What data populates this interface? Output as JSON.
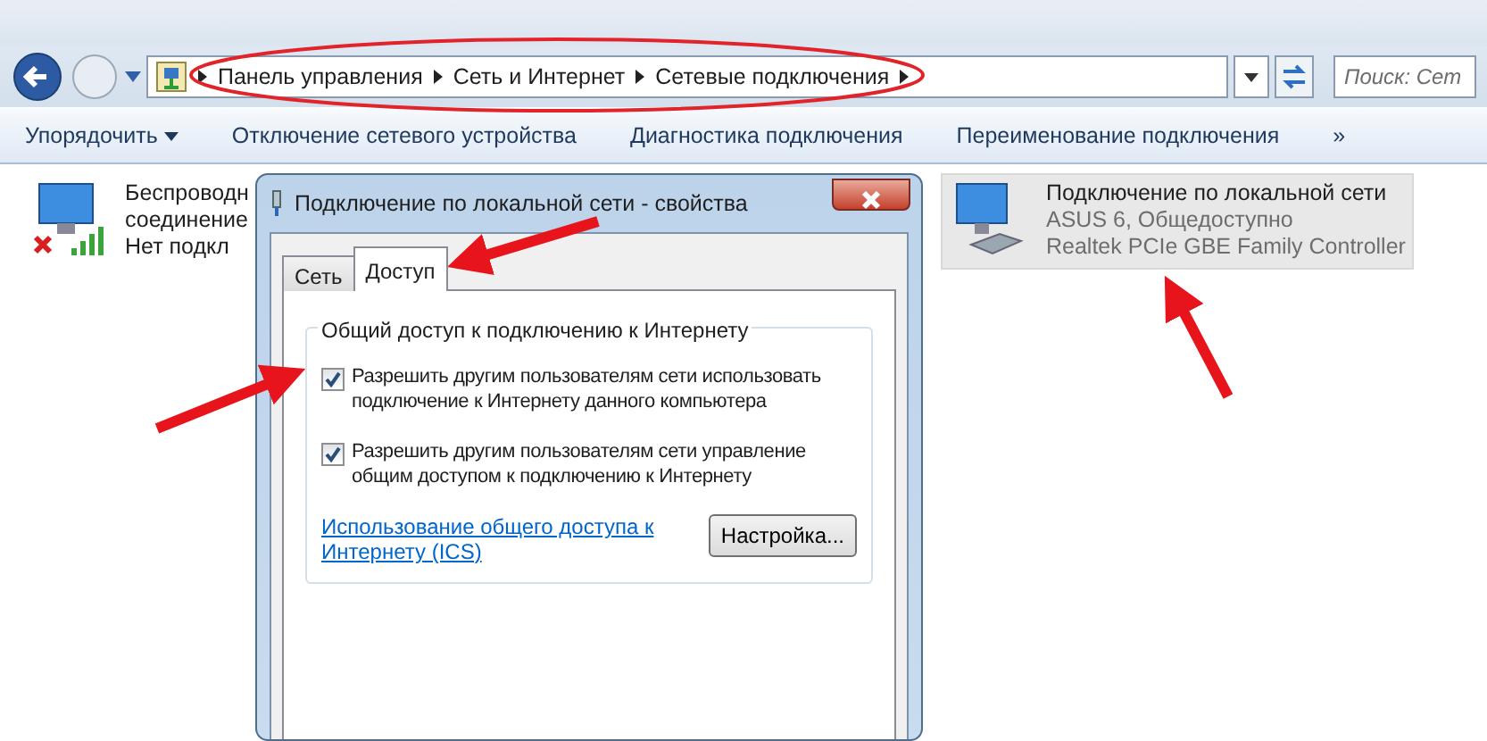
{
  "nav": {
    "breadcrumbs": [
      "Панель управления",
      "Сеть и Интернет",
      "Сетевые подключения"
    ],
    "search": {
      "placeholder": "Поиск: Сет"
    }
  },
  "toolbar": {
    "items": [
      {
        "label": "Упорядочить",
        "dropdown": true
      },
      {
        "label": "Отключение сетевого устройства",
        "dropdown": false
      },
      {
        "label": "Диагностика подключения",
        "dropdown": false
      },
      {
        "label": "Переименование подключения",
        "dropdown": false
      }
    ],
    "overflow": "»"
  },
  "connections": [
    {
      "kind": "wireless",
      "selected": false,
      "lines": [
        "Беспроводн",
        "соединение",
        "Нет подкл"
      ]
    },
    {
      "kind": "wired",
      "selected": true,
      "lines": [
        "Подключение по локальной сети",
        "ASUS  6, Общедоступно",
        "Realtek PCIe GBE Family Controller"
      ]
    }
  ],
  "dialog": {
    "title": "Подключение по локальной сети - свойства",
    "tabs": [
      {
        "label": "Сеть",
        "selected": false
      },
      {
        "label": "Доступ",
        "selected": true
      }
    ],
    "group": "Общий доступ к подключению к Интернету",
    "checkboxes": [
      {
        "label": "Разрешить другим пользователям сети использовать подключение к Интернету данного компьютера",
        "checked": true
      },
      {
        "label": "Разрешить другим пользователям сети управление общим доступом к подключению к Интернету",
        "checked": true
      }
    ],
    "link": "Использование общего доступа к Интернету (ICS)",
    "button": "Настройка..."
  }
}
